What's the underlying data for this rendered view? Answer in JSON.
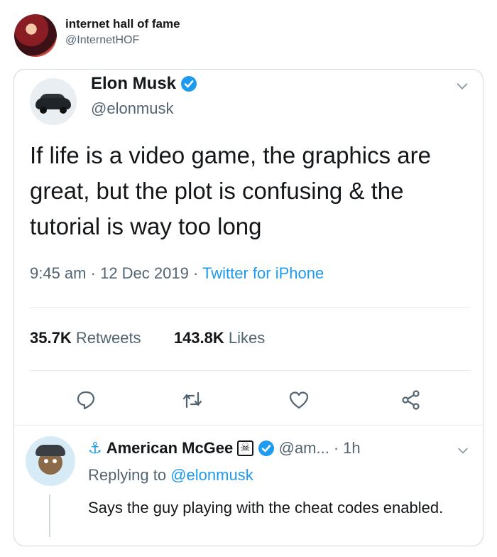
{
  "outer": {
    "name": "internet hall of fame",
    "handle": "@InternetHOF",
    "avatar_icon": "profile-avatar"
  },
  "tweet": {
    "author_name": "Elon Musk",
    "author_handle": "@elonmusk",
    "verified_icon": "verified-badge-icon",
    "text": "If life is a video game, the graphics are great, but the plot is confusing & the tutorial is way too long",
    "time": "9:45 am",
    "date": "12 Dec 2019",
    "source": "Twitter for iPhone",
    "sep": "·",
    "retweets_count": "35.7K",
    "retweets_label": "Retweets",
    "likes_count": "143.8K",
    "likes_label": "Likes"
  },
  "actions": [
    "reply-icon",
    "retweet-icon",
    "like-icon",
    "share-icon"
  ],
  "reply": {
    "anchor_glyph": "⚓",
    "author_name": "American McGee",
    "skull_glyph": "☠",
    "author_handle": "@am...",
    "sep": "·",
    "time": "1h",
    "replying_prefix": "Replying to",
    "replying_handle": "@elonmusk",
    "text": "Says the guy playing with the cheat codes enabled."
  },
  "colors": {
    "accent": "#1d9bf0",
    "text": "#14171a",
    "secondary": "#536471",
    "border": "#cfd9de"
  }
}
